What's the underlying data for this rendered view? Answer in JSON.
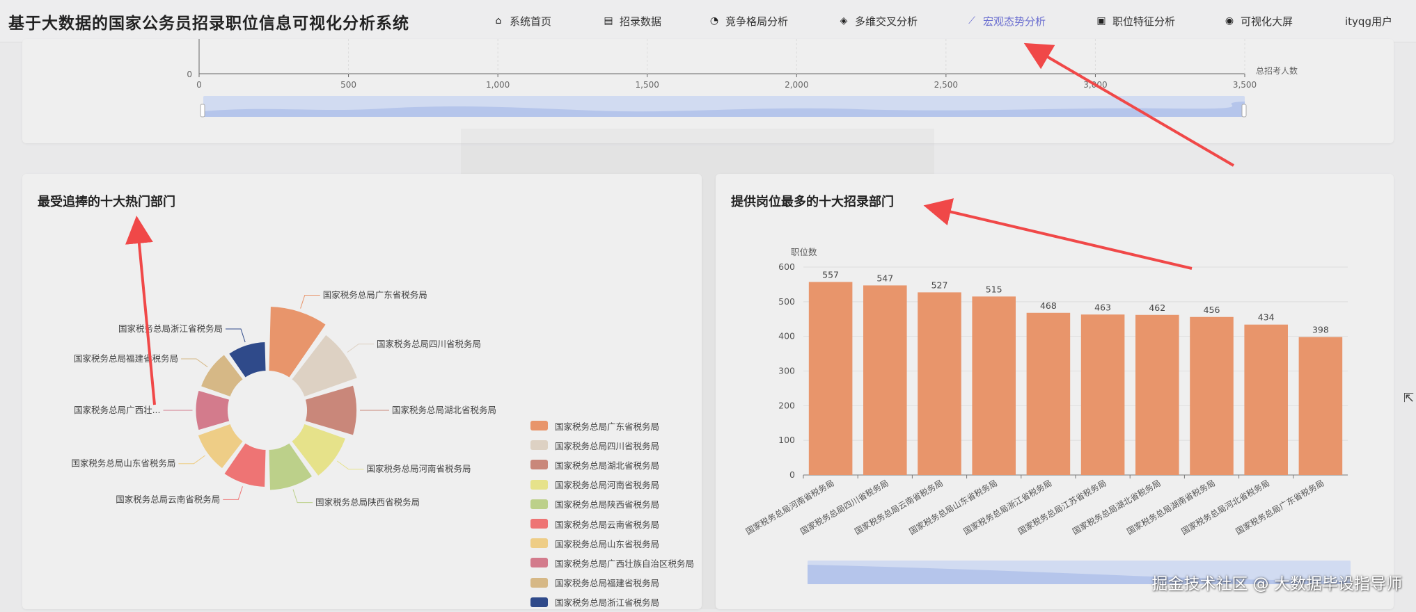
{
  "app": {
    "title": "基于大数据的国家公务员招录职位信息可视化分析系统",
    "user": "ityqg用户"
  },
  "nav": [
    {
      "label": "系统首页",
      "icon": "home-icon",
      "glyph": "⌂",
      "active": false
    },
    {
      "label": "招录数据",
      "icon": "clipboard-icon",
      "glyph": "▤",
      "active": false
    },
    {
      "label": "竞争格局分析",
      "icon": "pie-chart-icon",
      "glyph": "◔",
      "active": false
    },
    {
      "label": "多维交叉分析",
      "icon": "layers-icon",
      "glyph": "◈",
      "active": false
    },
    {
      "label": "宏观态势分析",
      "icon": "line-chart-icon",
      "glyph": "⟋",
      "active": true
    },
    {
      "label": "职位特征分析",
      "icon": "briefcase-icon",
      "glyph": "▣",
      "active": false
    },
    {
      "label": "可视化大屏",
      "icon": "dashboard-icon",
      "glyph": "◉",
      "active": false
    }
  ],
  "colors": {
    "accent": "#6b6fd0",
    "bar": "#e8956b",
    "arrow": "#f04848",
    "zoom": "#c7d4f2"
  },
  "top_chart": {
    "chart_data": {
      "type": "line",
      "xlabel": "总招考人数",
      "x_ticks": [
        "0",
        "500",
        "1,000",
        "1,500",
        "2,000",
        "2,500",
        "3,000",
        "3,500"
      ],
      "xlim": [
        0,
        3500
      ],
      "y_visible_tick": "0"
    }
  },
  "donut": {
    "title": "最受追捧的十大热门部门",
    "chart_data": {
      "type": "pie",
      "style": "rose-donut",
      "slices": [
        {
          "name": "国家税务总局广东省税务局",
          "label": "国家税务总局广东省税务局",
          "color": "#e8956b",
          "radius": 1.0
        },
        {
          "name": "国家税务总局四川省税务局",
          "label": "国家税务总局四川省税务局",
          "color": "#ddd1c3",
          "radius": 0.92
        },
        {
          "name": "国家税务总局湖北省税务局",
          "label": "国家税务总局湖北省税务局",
          "color": "#c9877a",
          "radius": 0.86
        },
        {
          "name": "国家税务总局河南省税务局",
          "label": "国家税务总局河南省税务局",
          "color": "#e6e28a",
          "radius": 0.8
        },
        {
          "name": "国家税务总局陕西省税务局",
          "label": "国家税务总局陕西省税务局",
          "color": "#bcd08a",
          "radius": 0.77
        },
        {
          "name": "国家税务总局云南省税务局",
          "label": "国家税务总局云南省税务局",
          "color": "#ee7474",
          "radius": 0.74
        },
        {
          "name": "国家税务总局山东省税务局",
          "label": "国家税务总局山东省税务局",
          "color": "#eecd86",
          "radius": 0.71
        },
        {
          "name": "国家税务总局广西壮族自治区税务局",
          "label": "国家税务总局广西壮...",
          "color": "#d37b8c",
          "radius": 0.69
        },
        {
          "name": "国家税务总局福建省税务局",
          "label": "国家税务总局福建省税务局",
          "color": "#d6b886",
          "radius": 0.68
        },
        {
          "name": "国家税务总局浙江省税务局",
          "label": "国家税务总局浙江省税务局",
          "color": "#2f4a8a",
          "radius": 0.66
        }
      ]
    }
  },
  "bars": {
    "title": "提供岗位最多的十大招录部门",
    "chart_data": {
      "type": "bar",
      "ylabel": "职位数",
      "ylim": [
        0,
        600
      ],
      "y_ticks": [
        0,
        100,
        200,
        300,
        400,
        500,
        600
      ],
      "categories": [
        "国家税务总局河南省税务局",
        "国家税务总局四川省税务局",
        "国家税务总局云南省税务局",
        "国家税务总局山东省税务局",
        "国家税务总局浙江省税务局",
        "国家税务总局江苏省税务局",
        "国家税务总局湖北省税务局",
        "国家税务总局湖南省税务局",
        "国家税务总局河北省税务局",
        "国家税务总局广东省税务局"
      ],
      "values": [
        557,
        547,
        527,
        515,
        468,
        463,
        462,
        456,
        434,
        398
      ]
    }
  },
  "watermark": "掘金技术社区 @ 大数据毕设指导师"
}
